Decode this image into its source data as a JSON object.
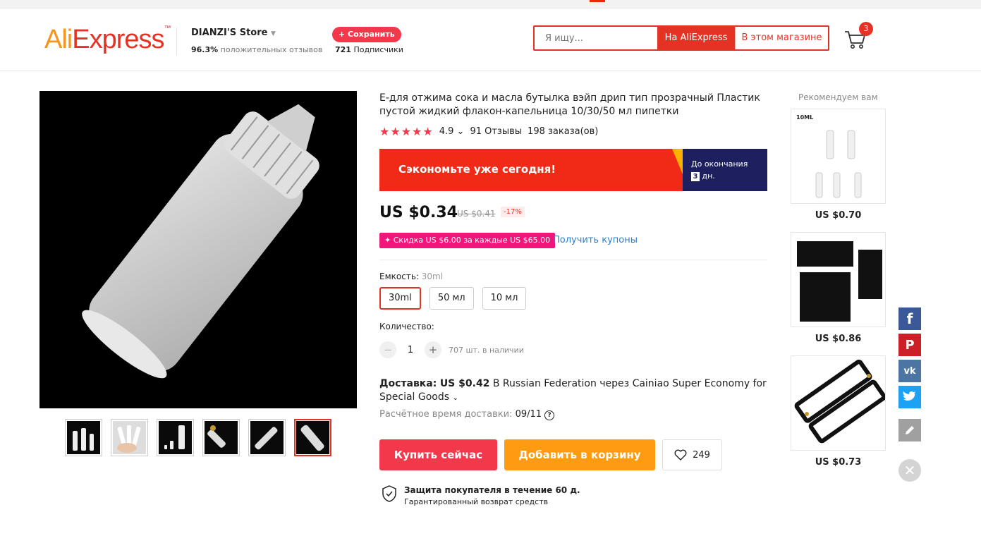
{
  "header": {
    "logo": {
      "ali": "Ali",
      "express": "Express",
      "tm": "™"
    },
    "store": {
      "name": "DIANZI'S Store",
      "positive_pct": "96.3%",
      "positive_label": "положительных отзывов",
      "save_label": "+ Сохранить",
      "subscribers_count": "721",
      "subscribers_label": "Подписчики"
    },
    "search": {
      "placeholder": "Я ищу...",
      "btn_aliexpress": "На AliExpress",
      "btn_store": "В этом магазине"
    },
    "cart_count": "3"
  },
  "product": {
    "title": "E-для отжима сока и масла бутылка вэйп дрип тип прозрачный Пластик пустой жидкий флакон-капельница 10/30/50 мл пипетки",
    "stars": "★★★★★",
    "rating": "4.9",
    "rating_caret": "⌄",
    "reviews": "91 Отзывы",
    "orders": "198 заказа(ов)",
    "banner": {
      "text": "Сэкономьте уже сегодня!",
      "countdown_label": "До окончания",
      "countdown_value": "3",
      "countdown_unit": "дн."
    },
    "price": "US $0.34",
    "old_price": "US $0.41",
    "discount": "-17%",
    "coupon": "✦ Скидка US $6.00 за каждые US $65.00",
    "get_coupons": "Получить купоны",
    "capacity_label": "Емкость:",
    "capacity_selected": "30ml",
    "options": [
      "30ml",
      "50 мл",
      "10 мл"
    ],
    "quantity_label": "Количество:",
    "quantity_value": "1",
    "minus": "−",
    "plus": "+",
    "stock": "707 шт. в наличии",
    "shipping_label": "Доставка:",
    "shipping_price": "US $0.42",
    "shipping_text": "В Russian Federation через Cainiao Super Economy for Special Goods",
    "eta_label": "Расчётное время доставки:",
    "eta_value": "09/11",
    "eta_help": "?",
    "buy_now": "Купить сейчас",
    "add_to_cart": "Добавить в корзину",
    "wishlist_count": "249",
    "protection_title": "Защита покупателя в течение 60 д.",
    "protection_sub": "Гарантированный возврат средств"
  },
  "recommend": {
    "title": "Рекомендуем вам",
    "items": [
      {
        "price": "US $0.70",
        "img_label": "10ML"
      },
      {
        "price": "US $0.86"
      },
      {
        "price": "US $0.73"
      }
    ]
  },
  "social": {
    "facebook": "f",
    "pinterest": "P",
    "vk": "vk",
    "twitter": "twitter-icon",
    "edit": "edit-icon",
    "close": "✕"
  },
  "colors": {
    "brand_red": "#e43225",
    "brand_orange": "#ff9b10",
    "accent_pink": "#f2157a",
    "link_blue": "#2e7fcc"
  }
}
